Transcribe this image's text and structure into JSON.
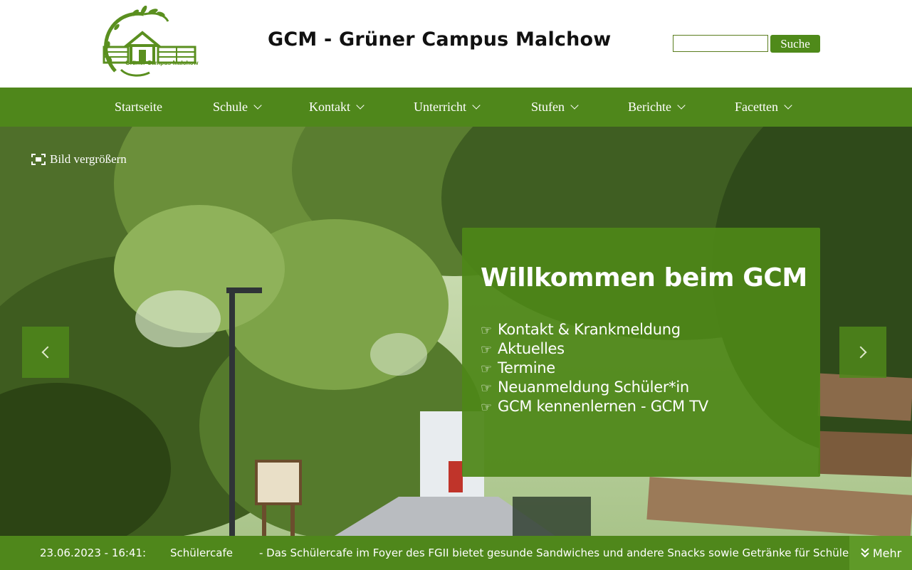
{
  "header": {
    "logo_text": "Grüner Campus Malchow",
    "title": "GCM - Grüner Campus Malchow",
    "search": {
      "value": "",
      "placeholder": "",
      "button_label": "Suche"
    }
  },
  "nav": {
    "items": [
      {
        "label": "Startseite",
        "has_dropdown": false
      },
      {
        "label": "Schule",
        "has_dropdown": true
      },
      {
        "label": "Kontakt",
        "has_dropdown": true
      },
      {
        "label": "Unterricht",
        "has_dropdown": true
      },
      {
        "label": "Stufen",
        "has_dropdown": true
      },
      {
        "label": "Berichte",
        "has_dropdown": true
      },
      {
        "label": "Facetten",
        "has_dropdown": true
      }
    ]
  },
  "hero": {
    "enlarge_label": "Bild vergrößern",
    "welcome_title": "Willkommen beim GCM",
    "bullet_glyph": "☞",
    "links": [
      "Kontakt & Krankmeldung",
      "Aktuelles",
      "Termine",
      "Neuanmeldung Schüler*in",
      "GCM kennenlernen - GCM TV"
    ]
  },
  "ticker": {
    "date": "23.06.2023 - 16:41:",
    "title": "Schülercafe",
    "text": "- Das Schülercafe im Foyer des FGII bietet gesunde Sandwiches und andere Snacks sowie Getränke für Schülerinnen",
    "more_label": "Mehr"
  },
  "colors": {
    "brand_green": "#4f871b",
    "box_green": "#4e8618",
    "button_green": "#4f8a1a",
    "more_green": "#5f9a28"
  }
}
